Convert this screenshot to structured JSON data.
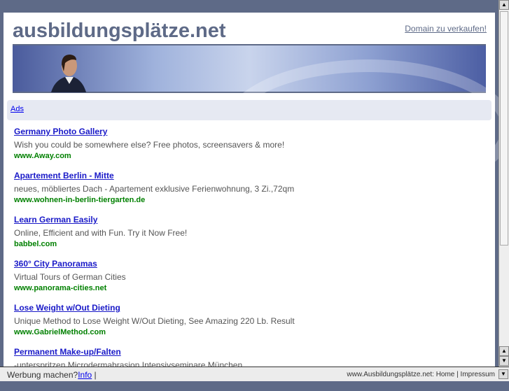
{
  "header": {
    "logo": "ausbildungsplätze.net",
    "sale_link": "Domain zu verkaufen!"
  },
  "ads_label": "Ads",
  "ads": [
    {
      "title": "Germany Photo Gallery",
      "desc": "Wish you could be somewhere else? Free photos, screensavers & more!",
      "url": "www.Away.com"
    },
    {
      "title": "Apartement Berlin - Mitte",
      "desc": "neues, möbliertes Dach - Apartement exklusive Ferienwohnung, 3 Zi.,72qm",
      "url": "www.wohnen-in-berlin-tiergarten.de"
    },
    {
      "title": "Learn German Easily",
      "desc": "Online, Efficient and with Fun. Try it Now Free!",
      "url": "babbel.com"
    },
    {
      "title": "360° City Panoramas",
      "desc": "Virtual Tours of German Cities",
      "url": "www.panorama-cities.net"
    },
    {
      "title": "Lose Weight w/Out Dieting",
      "desc": "Unique Method to Lose Weight W/Out Dieting, See Amazing 220 Lb. Result",
      "url": "www.GabrielMethod.com"
    },
    {
      "title": "Permanent Make-up/Falten",
      "desc": "-unterspritzen Microdermabrasion Intensivseminare München",
      "url": ""
    }
  ],
  "footer": {
    "ask": "Werbung machen?",
    "info": "Info",
    "sep": "|",
    "site": "www.Ausbildungsplätze.net:",
    "home": "Home",
    "impressum": "Impressum"
  }
}
